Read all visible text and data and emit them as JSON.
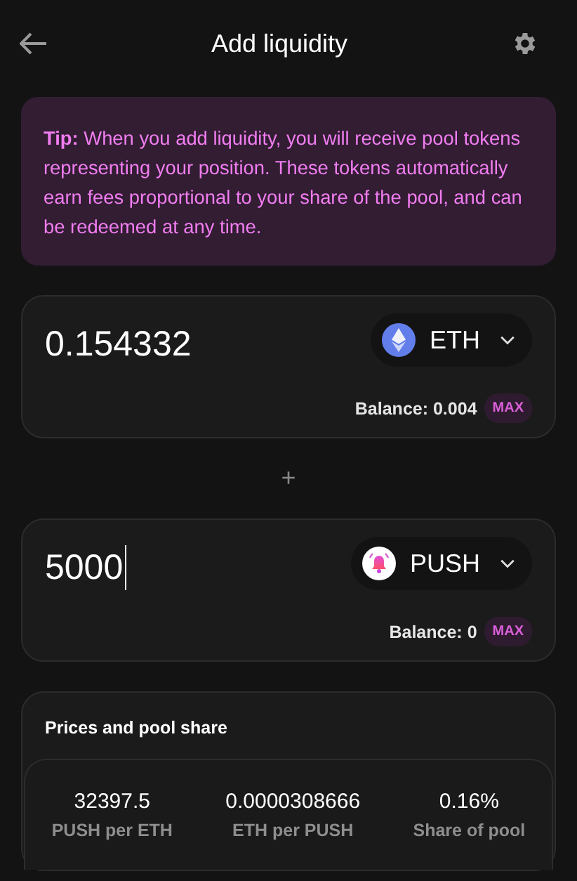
{
  "header": {
    "title": "Add liquidity"
  },
  "tip": "**Tip:** When you add liquidity, you will receive pool tokens representing your position. These tokens automatically earn fees proportional to your share of the pool, and can be redeemed at any time.",
  "inputs": [
    {
      "amount": "0.154332",
      "focused": false,
      "token": {
        "kind": "eth",
        "symbol": "ETH"
      },
      "balance": "Balance: 0.004",
      "max": "MAX"
    },
    {
      "amount": "5000",
      "focused": true,
      "token": {
        "kind": "push",
        "symbol": "PUSH"
      },
      "balance": "Balance: 0",
      "max": "MAX"
    }
  ],
  "separator": "+",
  "prices": {
    "title": "Prices and pool share",
    "stats": [
      {
        "value": "32397.5",
        "label": "PUSH per ETH"
      },
      {
        "value": "0.0000308666",
        "label": "ETH per PUSH"
      },
      {
        "value": "0.16%",
        "label": "Share of pool"
      }
    ]
  }
}
